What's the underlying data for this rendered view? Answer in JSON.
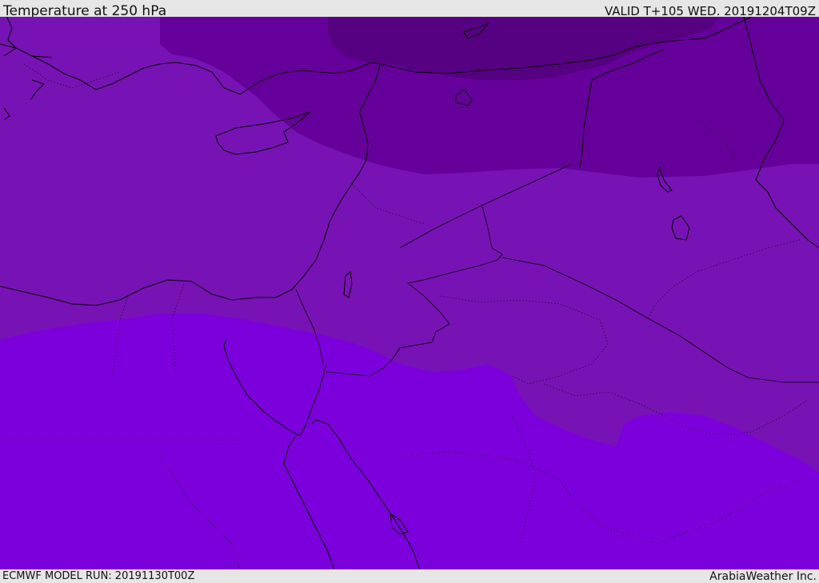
{
  "header": {
    "title": "Temperature at 250 hPa",
    "valid": "VALID T+105 WED. 20191204T09Z"
  },
  "footer": {
    "model_run": "ECMWF MODEL RUN: 20191130T00Z",
    "credit": "ArabiaWeather Inc."
  },
  "map": {
    "field": "Temperature at 250 hPa",
    "colors": {
      "coldest": "#560082",
      "colder": "#65009a",
      "mid": "#7713b5",
      "warm": "#7c00dc",
      "land_lines": "#000000"
    }
  }
}
